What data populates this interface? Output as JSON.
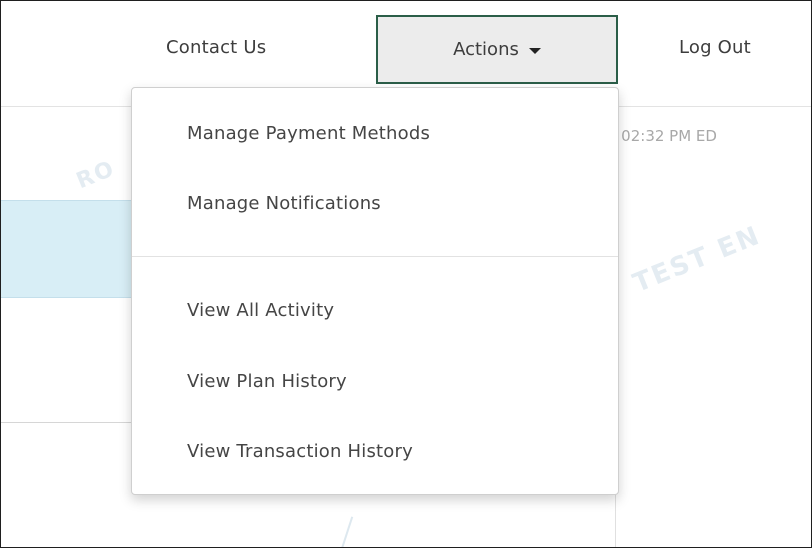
{
  "nav": {
    "contact_label": "Contact Us",
    "actions_label": "Actions",
    "logout_label": "Log Out"
  },
  "background": {
    "timestamp_text": "- 02:32 PM ED",
    "watermark_text": "TEST EN",
    "watermark_text_left": "RO"
  },
  "dropdown": {
    "items": [
      {
        "label": "Manage Payment Methods"
      },
      {
        "label": "Manage Notifications"
      },
      {
        "label": "View All Activity"
      },
      {
        "label": "View Plan History"
      },
      {
        "label": "View Transaction History"
      }
    ]
  },
  "colors": {
    "actions_border": "#2b5e48",
    "actions_bg": "#ececec",
    "highlight_row": "#d8eef6"
  },
  "icons": {
    "actions_caret": "caret-down-icon"
  }
}
